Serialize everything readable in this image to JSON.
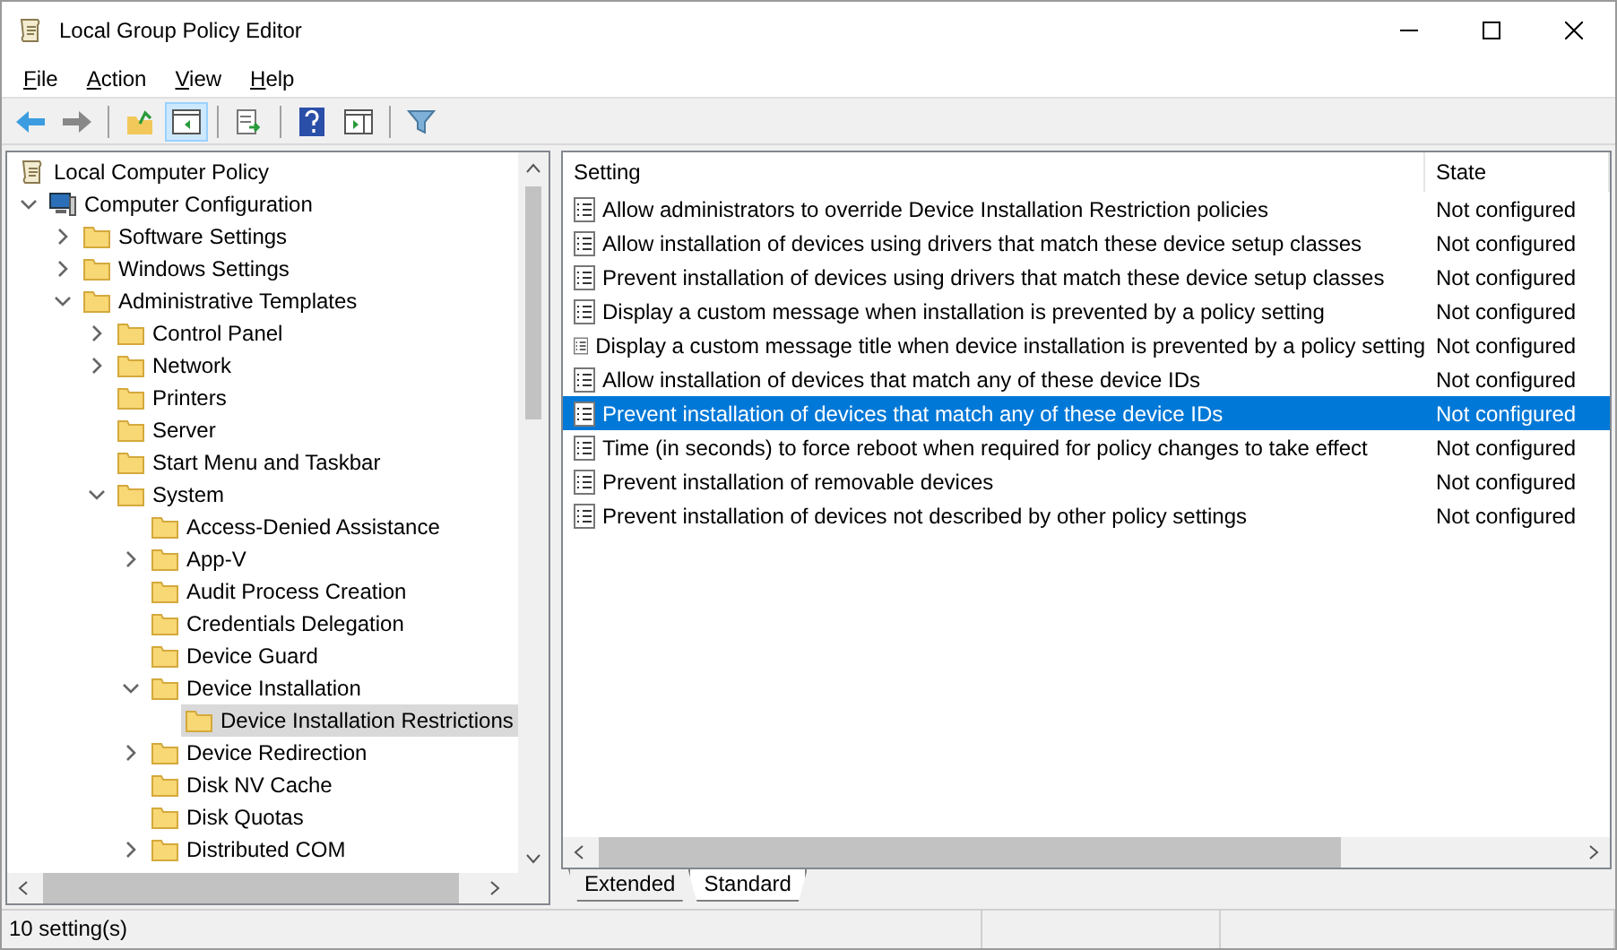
{
  "window": {
    "title": "Local Group Policy Editor"
  },
  "menu": [
    "File",
    "Action",
    "View",
    "Help"
  ],
  "toolbar": [
    {
      "kind": "back",
      "pressed": false
    },
    {
      "kind": "forward",
      "pressed": false
    },
    {
      "kind": "sep"
    },
    {
      "kind": "up",
      "pressed": false
    },
    {
      "kind": "tree",
      "pressed": true
    },
    {
      "kind": "sep"
    },
    {
      "kind": "export",
      "pressed": false
    },
    {
      "kind": "sep"
    },
    {
      "kind": "help",
      "pressed": false
    },
    {
      "kind": "pane",
      "pressed": false
    },
    {
      "kind": "sep"
    },
    {
      "kind": "filter",
      "pressed": false
    }
  ],
  "tree": [
    {
      "label": "Local Computer Policy",
      "kind": "root",
      "selected": false,
      "children": [
        {
          "label": "Computer Configuration",
          "kind": "computer",
          "expandable": true,
          "expanded": true,
          "selected": false,
          "children": [
            {
              "label": "Software Settings",
              "kind": "folder",
              "expandable": true,
              "expanded": false,
              "selected": false
            },
            {
              "label": "Windows Settings",
              "kind": "folder",
              "expandable": true,
              "expanded": false,
              "selected": false
            },
            {
              "label": "Administrative Templates",
              "kind": "folder",
              "expandable": true,
              "expanded": true,
              "selected": false,
              "children": [
                {
                  "label": "Control Panel",
                  "kind": "folder",
                  "expandable": true,
                  "expanded": false,
                  "selected": false
                },
                {
                  "label": "Network",
                  "kind": "folder",
                  "expandable": true,
                  "expanded": false,
                  "selected": false
                },
                {
                  "label": "Printers",
                  "kind": "folder",
                  "expandable": false,
                  "selected": false
                },
                {
                  "label": "Server",
                  "kind": "folder",
                  "expandable": false,
                  "selected": false
                },
                {
                  "label": "Start Menu and Taskbar",
                  "kind": "folder",
                  "expandable": false,
                  "selected": false
                },
                {
                  "label": "System",
                  "kind": "folder",
                  "expandable": true,
                  "expanded": true,
                  "selected": false,
                  "children": [
                    {
                      "label": "Access-Denied Assistance",
                      "kind": "folder",
                      "expandable": false,
                      "selected": false
                    },
                    {
                      "label": "App-V",
                      "kind": "folder",
                      "expandable": true,
                      "expanded": false,
                      "selected": false
                    },
                    {
                      "label": "Audit Process Creation",
                      "kind": "folder",
                      "expandable": false,
                      "selected": false
                    },
                    {
                      "label": "Credentials Delegation",
                      "kind": "folder",
                      "expandable": false,
                      "selected": false
                    },
                    {
                      "label": "Device Guard",
                      "kind": "folder",
                      "expandable": false,
                      "selected": false
                    },
                    {
                      "label": "Device Installation",
                      "kind": "folder",
                      "expandable": true,
                      "expanded": true,
                      "selected": false,
                      "children": [
                        {
                          "label": "Device Installation Restrictions",
                          "kind": "folder",
                          "expandable": false,
                          "selected": true
                        }
                      ]
                    },
                    {
                      "label": "Device Redirection",
                      "kind": "folder",
                      "expandable": true,
                      "expanded": false,
                      "selected": false
                    },
                    {
                      "label": "Disk NV Cache",
                      "kind": "folder",
                      "expandable": false,
                      "selected": false
                    },
                    {
                      "label": "Disk Quotas",
                      "kind": "folder",
                      "expandable": false,
                      "selected": false
                    },
                    {
                      "label": "Distributed COM",
                      "kind": "folder",
                      "expandable": true,
                      "expanded": false,
                      "selected": false
                    }
                  ]
                }
              ]
            }
          ]
        }
      ]
    }
  ],
  "columns": [
    "Setting",
    "State"
  ],
  "rows": [
    {
      "setting": "Allow administrators to override Device Installation Restriction policies",
      "state": "Not configured",
      "selected": false
    },
    {
      "setting": "Allow installation of devices using drivers that match these device setup classes",
      "state": "Not configured",
      "selected": false
    },
    {
      "setting": "Prevent installation of devices using drivers that match these device setup classes",
      "state": "Not configured",
      "selected": false
    },
    {
      "setting": "Display a custom message when installation is prevented by a policy setting",
      "state": "Not configured",
      "selected": false
    },
    {
      "setting": "Display a custom message title when device installation is prevented by a policy setting",
      "state": "Not configured",
      "selected": false
    },
    {
      "setting": "Allow installation of devices that match any of these device IDs",
      "state": "Not configured",
      "selected": false
    },
    {
      "setting": "Prevent installation of devices that match any of these device IDs",
      "state": "Not configured",
      "selected": true
    },
    {
      "setting": "Time (in seconds) to force reboot when required for policy changes to take effect",
      "state": "Not configured",
      "selected": false
    },
    {
      "setting": "Prevent installation of removable devices",
      "state": "Not configured",
      "selected": false
    },
    {
      "setting": "Prevent installation of devices not described by other policy settings",
      "state": "Not configured",
      "selected": false
    }
  ],
  "view_tabs": [
    {
      "label": "Extended",
      "selected": false
    },
    {
      "label": "Standard",
      "selected": true
    }
  ],
  "status_bar": "10 setting(s)"
}
